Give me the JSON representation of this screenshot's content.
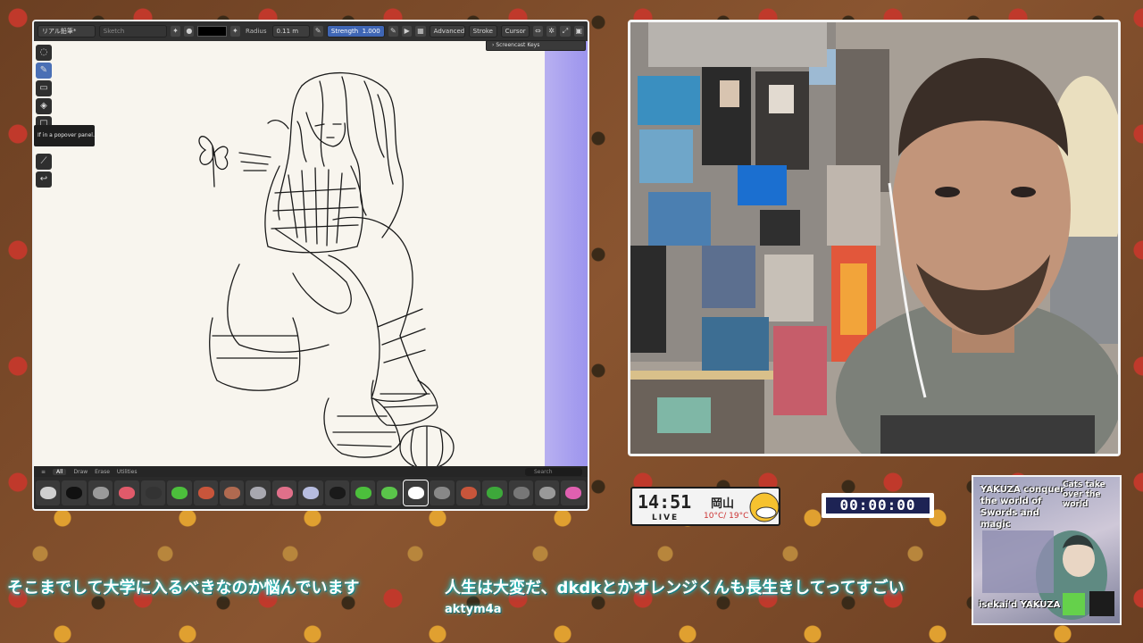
{
  "app": {
    "brush_preset": "リアル鉛筆*",
    "layer_name": "Sketch",
    "radius_label": "Radius",
    "radius_value": "0.11 m",
    "strength_label": "Strength",
    "strength_value": "1.000",
    "menus": [
      "Advanced",
      "Stroke",
      "Cursor"
    ],
    "screencast_label": "Screencast Keys",
    "tooltip": "If in a popover panel.",
    "tabs": [
      "All",
      "Draw",
      "Erase",
      "Utilities"
    ],
    "search_placeholder": "Search",
    "tool_icons": [
      "cursor-icon",
      "draw-icon",
      "erase-icon",
      "fill-icon",
      "box-icon",
      "eyedropper-icon",
      "transform-icon"
    ],
    "brush_colors": [
      "#cfcfcf",
      "#111111",
      "#9a9a9a",
      "#e05a6a",
      "#333333",
      "#4cbf3c",
      "#c8553b",
      "#b06a50",
      "#a8a8b0",
      "#e0708a",
      "#b7bde0",
      "#1a1a1a",
      "#4cbf3c",
      "#5ac54a",
      "#ffffff",
      "#888888",
      "#c8553b",
      "#3da83a",
      "#777777",
      "#999999",
      "#e060b0"
    ]
  },
  "clock": {
    "time": "14:51",
    "live": "LIVE",
    "city": "岡山",
    "temp": "10°C/ 19°C"
  },
  "timer": "00:00:00",
  "cover": {
    "title_left": "YAKUZA conquer the world of Swords and magic",
    "title_right": "Cats take over the world",
    "bottom": "isekai'd YAKUZA"
  },
  "subtitles": {
    "left": "そこまでして大学に入るべきなのか悩んでいます",
    "right": "人生は大変だ、dkdkとかオレンジくんも長生きしてってすごい",
    "user": "aktym4a"
  }
}
